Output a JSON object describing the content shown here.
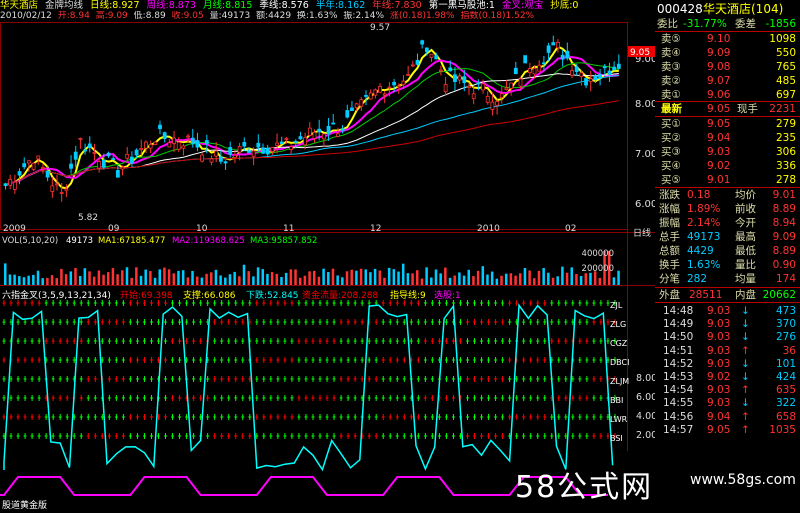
{
  "topbar": {
    "title": "华天酒店",
    "indicator": "金牌均线",
    "ma_daily": "日线:8.927",
    "ma_weekly": "周线:8.873",
    "ma_monthly": "月线:8.815",
    "ma_season": "季线:8.576",
    "ma_half": "半年:8.162",
    "ma_year": "年线:7.830",
    "signal": "第一黑马股池:1",
    "status": "金叉:观宝",
    "bottom": "抄底:0"
  },
  "infobar": {
    "date": "2010/02/12",
    "open": "开:8.94",
    "high": "高:9.09",
    "low": "低:8.89",
    "close": "收:9.05",
    "vol": "量:49173",
    "amount": "额:4429",
    "turnover": "换:1.63%",
    "amplitude": "振:2.14%",
    "change": "涨(0.18)1.98%",
    "index": "指数(0.18)1.52%"
  },
  "main": {
    "price_axis": [
      "9.00",
      "8.00",
      "7.00",
      "6.00"
    ],
    "price_tag": "9.05",
    "high_label": "9.57",
    "low_label": "5.82",
    "months": [
      "2009",
      "09",
      "10",
      "11",
      "12",
      "2010",
      "02"
    ],
    "period": "日线"
  },
  "vol_panel": {
    "label": "VOL(5,10,20)",
    "vol": "49173",
    "ma1": "MA1:67185.477",
    "ma2": "MA2:119368.625",
    "ma3": "MA3:95857.852",
    "axis": [
      "400000",
      "200000"
    ]
  },
  "six_panel": {
    "title": "六指金叉(3,5,9,13,21,34)",
    "pressure": "开始:69.398",
    "support": "支撑:66.086",
    "down": "下跌:52.845",
    "capital": "资金流量:208.288",
    "guide": "指导线:9",
    "select": "选股:1",
    "rows": [
      "ZJL",
      "ZLG",
      "CGZ",
      "DBCI",
      "ZLJM",
      "BBI",
      "LWR",
      "BSI"
    ],
    "axis": [
      "8.00",
      "6.00",
      "4.00",
      "2.00"
    ],
    "bottom_label": "股道黄金版"
  },
  "quote": {
    "code": "000428",
    "name": "华天酒店(104)",
    "weibi_label": "委比",
    "weibi": "-31.77%",
    "weicha_label": "委差",
    "weicha": "-1856",
    "sell": [
      {
        "label": "卖⑤",
        "price": "9.10",
        "vol": "1098"
      },
      {
        "label": "卖④",
        "price": "9.09",
        "vol": "550"
      },
      {
        "label": "卖③",
        "price": "9.08",
        "vol": "765"
      },
      {
        "label": "卖②",
        "price": "9.07",
        "vol": "485"
      },
      {
        "label": "卖①",
        "price": "9.06",
        "vol": "697"
      }
    ],
    "latest_label": "最新",
    "latest": "9.05",
    "xianshou_label": "现手",
    "xianshou": "2231",
    "buy": [
      {
        "label": "买①",
        "price": "9.05",
        "vol": "279"
      },
      {
        "label": "买②",
        "price": "9.04",
        "vol": "235"
      },
      {
        "label": "买③",
        "price": "9.03",
        "vol": "306"
      },
      {
        "label": "买④",
        "price": "9.02",
        "vol": "336"
      },
      {
        "label": "买⑤",
        "price": "9.01",
        "vol": "278"
      }
    ],
    "stats": [
      {
        "l1": "涨跌",
        "v1": "0.18",
        "l2": "均价",
        "v2": "9.01"
      },
      {
        "l1": "涨幅",
        "v1": "1.89%",
        "l2": "前收",
        "v2": "8.89"
      },
      {
        "l1": "振幅",
        "v1": "2.14%",
        "l2": "今开",
        "v2": "8.94"
      },
      {
        "l1": "总手",
        "v1": "49173",
        "l2": "最高",
        "v2": "9.09"
      },
      {
        "l1": "总额",
        "v1": "4429",
        "l2": "最低",
        "v2": "8.89"
      },
      {
        "l1": "换手",
        "v1": "1.63%",
        "l2": "量比",
        "v2": "0.90"
      },
      {
        "l1": "分笔",
        "v1": "282",
        "l2": "均量",
        "v2": "174"
      }
    ],
    "waipan_label": "外盘",
    "waipan": "28511",
    "neipan_label": "内盘",
    "neipan": "20662",
    "ticks": [
      {
        "time": "14:48",
        "price": "9.03",
        "dir": "↓",
        "vol": "473"
      },
      {
        "time": "14:49",
        "price": "9.03",
        "dir": "↓",
        "vol": "370"
      },
      {
        "time": "14:50",
        "price": "9.03",
        "dir": "↓",
        "vol": "276"
      },
      {
        "time": "14:51",
        "price": "9.03",
        "dir": "↑",
        "vol": "36"
      },
      {
        "time": "14:52",
        "price": "9.03",
        "dir": "↓",
        "vol": "101"
      },
      {
        "time": "14:53",
        "price": "9.02",
        "dir": "↓",
        "vol": "424"
      },
      {
        "time": "14:54",
        "price": "9.03",
        "dir": "↑",
        "vol": "635"
      },
      {
        "time": "14:55",
        "price": "9.03",
        "dir": "↓",
        "vol": "322"
      },
      {
        "time": "14:56",
        "price": "9.04",
        "dir": "↑",
        "vol": "658"
      },
      {
        "time": "14:57",
        "price": "9.05",
        "dir": "↑",
        "vol": "1035"
      }
    ]
  },
  "watermark": {
    "text": "58公式网",
    "url": "www.58gs.com"
  }
}
